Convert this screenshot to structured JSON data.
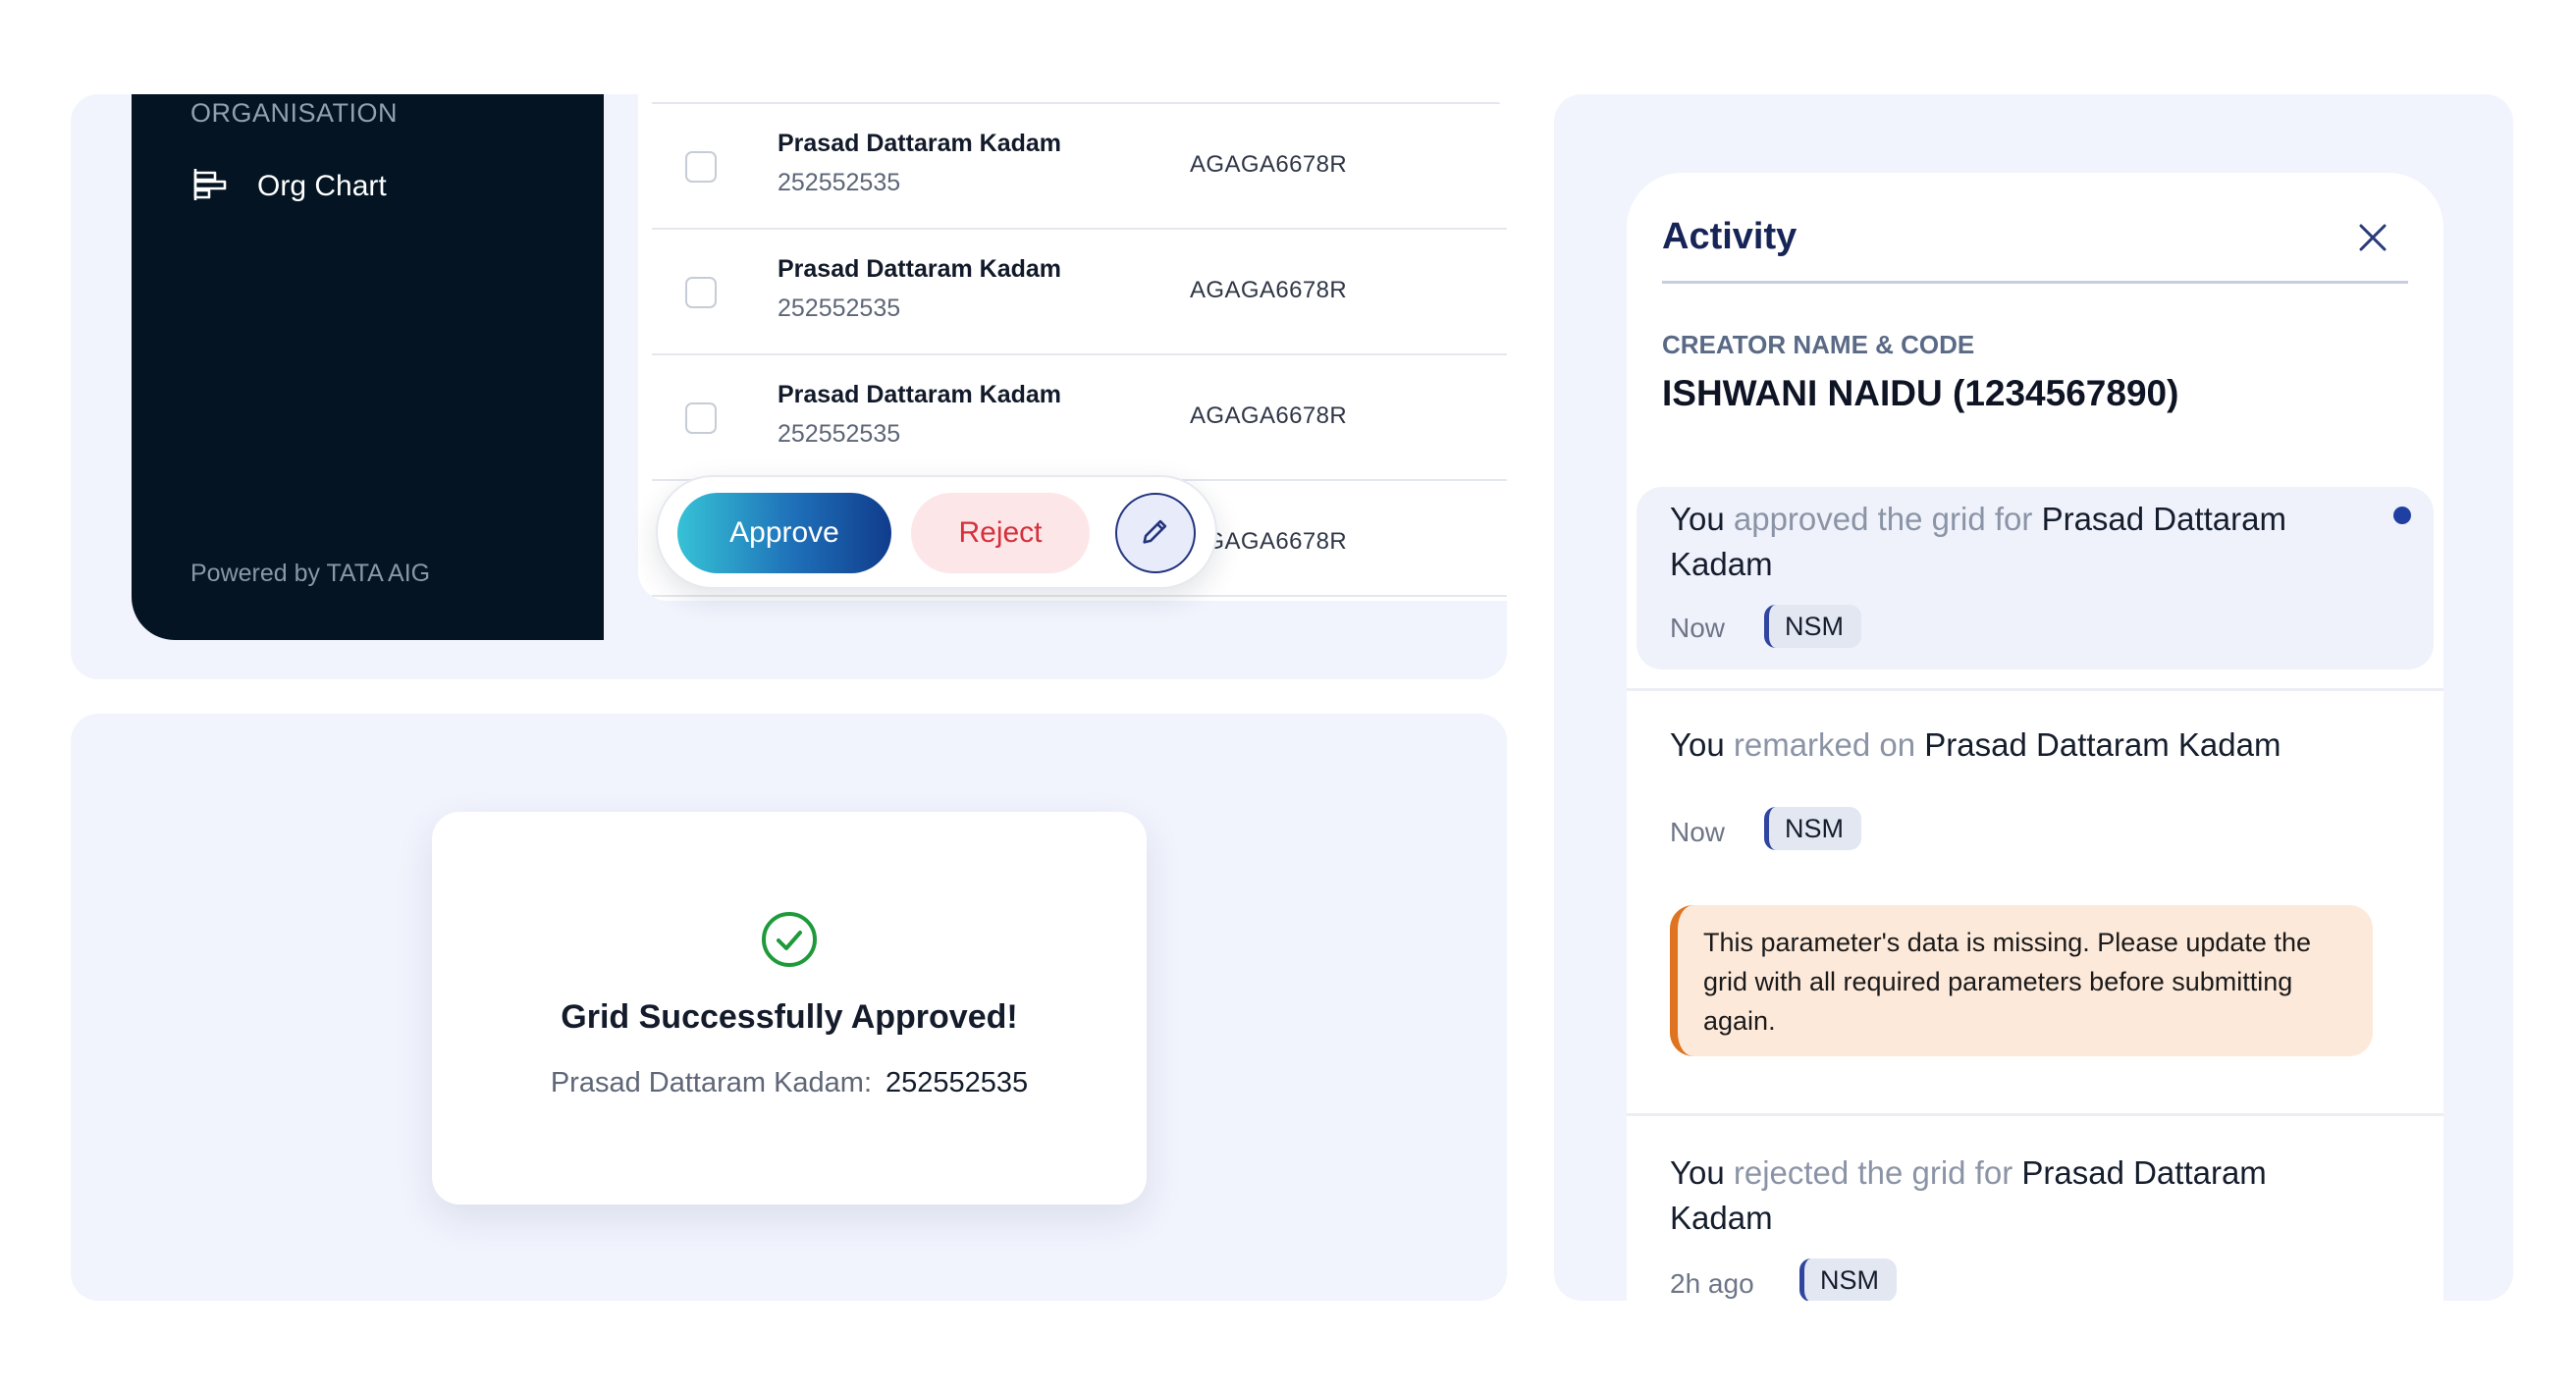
{
  "sidebar": {
    "section_heading": "ORGANISATION",
    "item_label": "Org Chart",
    "footer": "Powered by TATA AIG"
  },
  "table": {
    "rows": [
      {
        "name": "Prasad Dattaram Kadam",
        "code": "252552535",
        "pan": "AGAGA6678R"
      },
      {
        "name": "Prasad Dattaram Kadam",
        "code": "252552535",
        "pan": "AGAGA6678R"
      },
      {
        "name": "Prasad Dattaram Kadam",
        "code": "252552535",
        "pan": "AGAGA6678R"
      },
      {
        "name": "",
        "code": "",
        "pan": "AGAGA6678R"
      }
    ]
  },
  "actions": {
    "approve_label": "Approve",
    "reject_label": "Reject",
    "edit_icon": "pencil-icon"
  },
  "toast": {
    "icon": "check-circle-icon",
    "title": "Grid Successfully Approved!",
    "detail_label": "Prasad Dattaram Kadam:",
    "detail_value": "252552535"
  },
  "activity": {
    "title": "Activity",
    "close_icon": "close-icon",
    "creator_label": "CREATOR NAME & CODE",
    "creator_value": "ISHWANI NAIDU (1234567890)",
    "items": [
      {
        "actor": "You",
        "action": "approved the grid for",
        "target_line1": "Prasad Dattaram",
        "target_line2": "Kadam",
        "time": "Now",
        "tag": "NSM",
        "unread": true
      },
      {
        "actor": "You",
        "action": "remarked on",
        "target": "Prasad Dattaram Kadam",
        "time": "Now",
        "tag": "NSM",
        "note": "This parameter's data is missing. Please update the grid with all required parameters before submitting again."
      },
      {
        "actor": "You",
        "action": "rejected the grid for",
        "target_line1": "Prasad Dattaram",
        "target_line2": "Kadam",
        "time": "2h ago",
        "tag": "NSM"
      }
    ]
  },
  "colors": {
    "sidebar_bg": "#041422",
    "accent_navy": "#172457",
    "reject_red": "#d5303b",
    "success_green": "#1f9a3a",
    "note_orange": "#e0731f",
    "panel_bg": "#f1f4fd"
  }
}
